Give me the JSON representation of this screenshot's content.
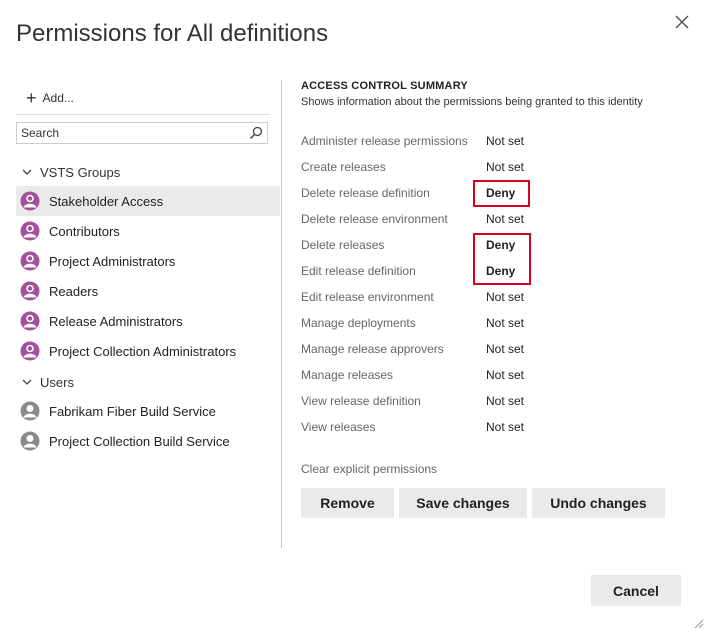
{
  "dialog": {
    "title": "Permissions for All definitions",
    "close_icon": "close-icon"
  },
  "sidebar": {
    "add_label": "Add...",
    "search": {
      "placeholder": "Search",
      "value": ""
    },
    "groups": [
      {
        "label": "VSTS Groups",
        "expanded": true
      },
      {
        "label": "Users",
        "expanded": true
      }
    ],
    "vsts_items": [
      {
        "label": "Stakeholder Access",
        "selected": true,
        "icon": "group-icon"
      },
      {
        "label": "Contributors",
        "icon": "group-icon"
      },
      {
        "label": "Project Administrators",
        "icon": "group-icon"
      },
      {
        "label": "Readers",
        "icon": "group-icon"
      },
      {
        "label": "Release Administrators",
        "icon": "group-icon"
      },
      {
        "label": "Project Collection Administrators",
        "icon": "group-icon"
      }
    ],
    "user_items": [
      {
        "label": "Fabrikam Fiber Build Service",
        "icon": "user-icon"
      },
      {
        "label": "Project Collection Build Service",
        "icon": "user-icon"
      }
    ]
  },
  "summary": {
    "title": "ACCESS CONTROL SUMMARY",
    "subtitle": "Shows information about the permissions being granted to this identity",
    "permissions": [
      {
        "name": "Administer release permissions",
        "value": "Not set"
      },
      {
        "name": "Create releases",
        "value": "Not set"
      },
      {
        "name": "Delete release definition",
        "value": "Deny"
      },
      {
        "name": "Delete release environment",
        "value": "Not set"
      },
      {
        "name": "Delete releases",
        "value": "Deny"
      },
      {
        "name": "Edit release definition",
        "value": "Deny"
      },
      {
        "name": "Edit release environment",
        "value": "Not set"
      },
      {
        "name": "Manage deployments",
        "value": "Not set"
      },
      {
        "name": "Manage release approvers",
        "value": "Not set"
      },
      {
        "name": "Manage releases",
        "value": "Not set"
      },
      {
        "name": "View release definition",
        "value": "Not set"
      },
      {
        "name": "View releases",
        "value": "Not set"
      }
    ],
    "clear_label": "Clear explicit permissions",
    "buttons": {
      "remove": "Remove",
      "save": "Save changes",
      "undo": "Undo changes"
    }
  },
  "footer": {
    "cancel": "Cancel"
  },
  "colors": {
    "highlight": "#d9001b",
    "group_icon": "#a44e9e",
    "user_icon": "#8a8a8a",
    "selected_bg": "#eaeaea"
  }
}
